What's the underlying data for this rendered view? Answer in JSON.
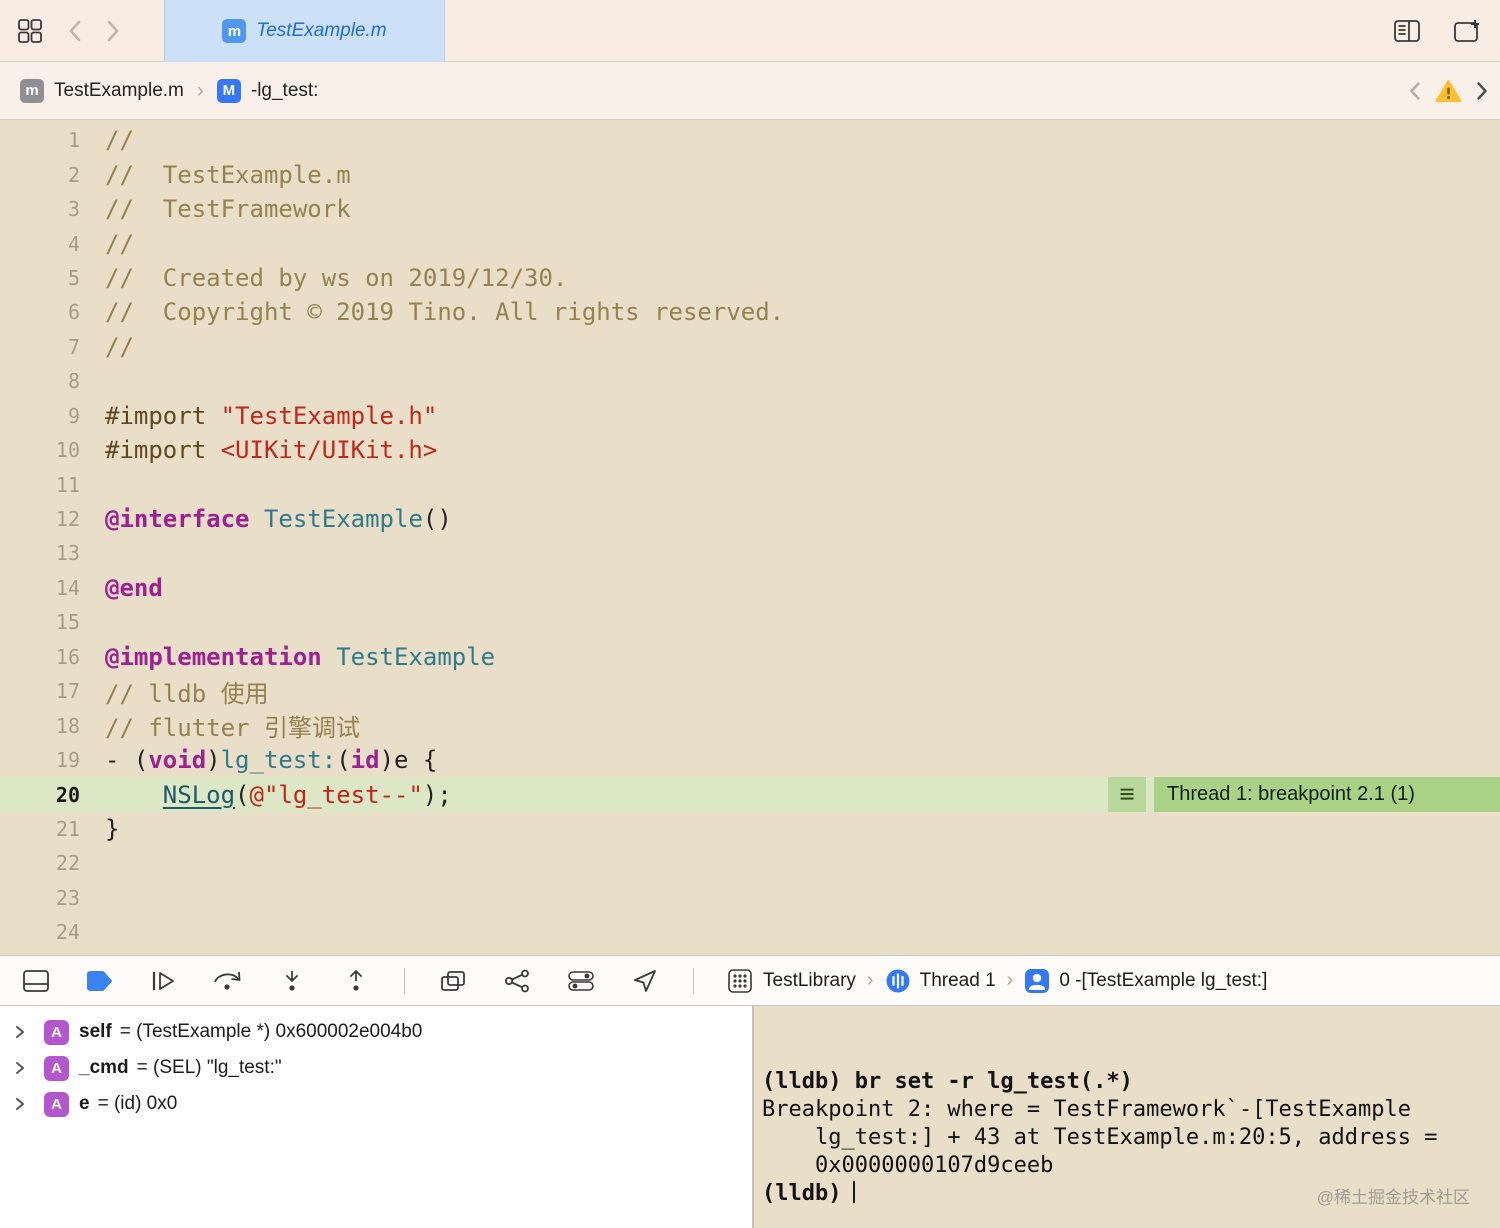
{
  "tab_bar": {
    "tab_title": "TestExample.m",
    "tab_icon_letter": "m"
  },
  "jump_bar": {
    "file_icon_letter": "m",
    "file_name": "TestExample.m",
    "separator": "›",
    "symbol_icon_letter": "M",
    "symbol_name": "-lg_test:"
  },
  "editor": {
    "breakpoint_line": 20,
    "breakpoint_annotation": "Thread 1: breakpoint 2.1 (1)",
    "breakpoint_marker_glyph": "≡",
    "lines": [
      {
        "n": 1,
        "segs": [
          [
            "//",
            "cmt"
          ]
        ]
      },
      {
        "n": 2,
        "segs": [
          [
            "//  TestExample.m",
            "cmt"
          ]
        ]
      },
      {
        "n": 3,
        "segs": [
          [
            "//  TestFramework",
            "cmt"
          ]
        ]
      },
      {
        "n": 4,
        "segs": [
          [
            "//",
            "cmt"
          ]
        ]
      },
      {
        "n": 5,
        "segs": [
          [
            "//  Created by ws on 2019/12/30.",
            "cmt"
          ]
        ]
      },
      {
        "n": 6,
        "segs": [
          [
            "//  Copyright © 2019 Tino. All rights reserved.",
            "cmt"
          ]
        ]
      },
      {
        "n": 7,
        "segs": [
          [
            "//",
            "cmt"
          ]
        ]
      },
      {
        "n": 8,
        "segs": []
      },
      {
        "n": 9,
        "segs": [
          [
            "#import ",
            "pre"
          ],
          [
            "\"TestExample.h\"",
            "str"
          ]
        ]
      },
      {
        "n": 10,
        "segs": [
          [
            "#import ",
            "pre"
          ],
          [
            "<UIKit/UIKit.h>",
            "str"
          ]
        ]
      },
      {
        "n": 11,
        "segs": []
      },
      {
        "n": 12,
        "segs": [
          [
            "@interface ",
            "kw"
          ],
          [
            "TestExample",
            "cls"
          ],
          [
            "()",
            "pln"
          ]
        ]
      },
      {
        "n": 13,
        "segs": []
      },
      {
        "n": 14,
        "segs": [
          [
            "@end",
            "kw"
          ]
        ]
      },
      {
        "n": 15,
        "segs": []
      },
      {
        "n": 16,
        "segs": [
          [
            "@implementation ",
            "kw"
          ],
          [
            "TestExample",
            "cls"
          ]
        ]
      },
      {
        "n": 17,
        "segs": [
          [
            "// lldb 使用",
            "cmt"
          ]
        ]
      },
      {
        "n": 18,
        "segs": [
          [
            "// flutter 引擎调试",
            "cmt"
          ]
        ]
      },
      {
        "n": 19,
        "segs": [
          [
            "- (",
            "pln"
          ],
          [
            "void",
            "kw"
          ],
          [
            ")",
            "pln"
          ],
          [
            "lg_test:",
            "fn"
          ],
          [
            "(",
            "pln"
          ],
          [
            "id",
            "kw"
          ],
          [
            ")e {",
            "pln"
          ]
        ]
      },
      {
        "n": 20,
        "segs": [
          [
            "    ",
            "pln"
          ],
          [
            "NSLog",
            "fnu"
          ],
          [
            "(",
            "pln"
          ],
          [
            "@\"lg_test--\"",
            "str"
          ],
          [
            ");",
            "pln"
          ]
        ]
      },
      {
        "n": 21,
        "segs": [
          [
            "}",
            "pln"
          ]
        ]
      },
      {
        "n": 22,
        "segs": []
      },
      {
        "n": 23,
        "segs": []
      },
      {
        "n": 24,
        "segs": []
      }
    ]
  },
  "debug_toolbar": {
    "target_label": "TestLibrary",
    "thread_label": "Thread 1",
    "frame_label": "0 -[TestExample lg_test:]"
  },
  "variables_view": {
    "items": [
      {
        "badge": "A",
        "name": "self",
        "value": "= (TestExample *) 0x600002e004b0"
      },
      {
        "badge": "A",
        "name": "_cmd",
        "value": "= (SEL) \"lg_test:\""
      },
      {
        "badge": "A",
        "name": "e",
        "value": "= (id) 0x0"
      }
    ]
  },
  "console": {
    "lines": [
      {
        "text": "(lldb) br set -r lg_test(.*)",
        "bold": true,
        "cursor": false
      },
      {
        "text": "Breakpoint 2: where = TestFramework`-[TestExample",
        "bold": false,
        "cursor": false
      },
      {
        "text": "    lg_test:] + 43 at TestExample.m:20:5, address =",
        "bold": false,
        "cursor": false
      },
      {
        "text": "    0x0000000107d9ceeb",
        "bold": false,
        "cursor": false
      },
      {
        "text": "(lldb)",
        "bold": true,
        "cursor": true
      }
    ],
    "watermark": "@稀土掘金技术社区"
  }
}
